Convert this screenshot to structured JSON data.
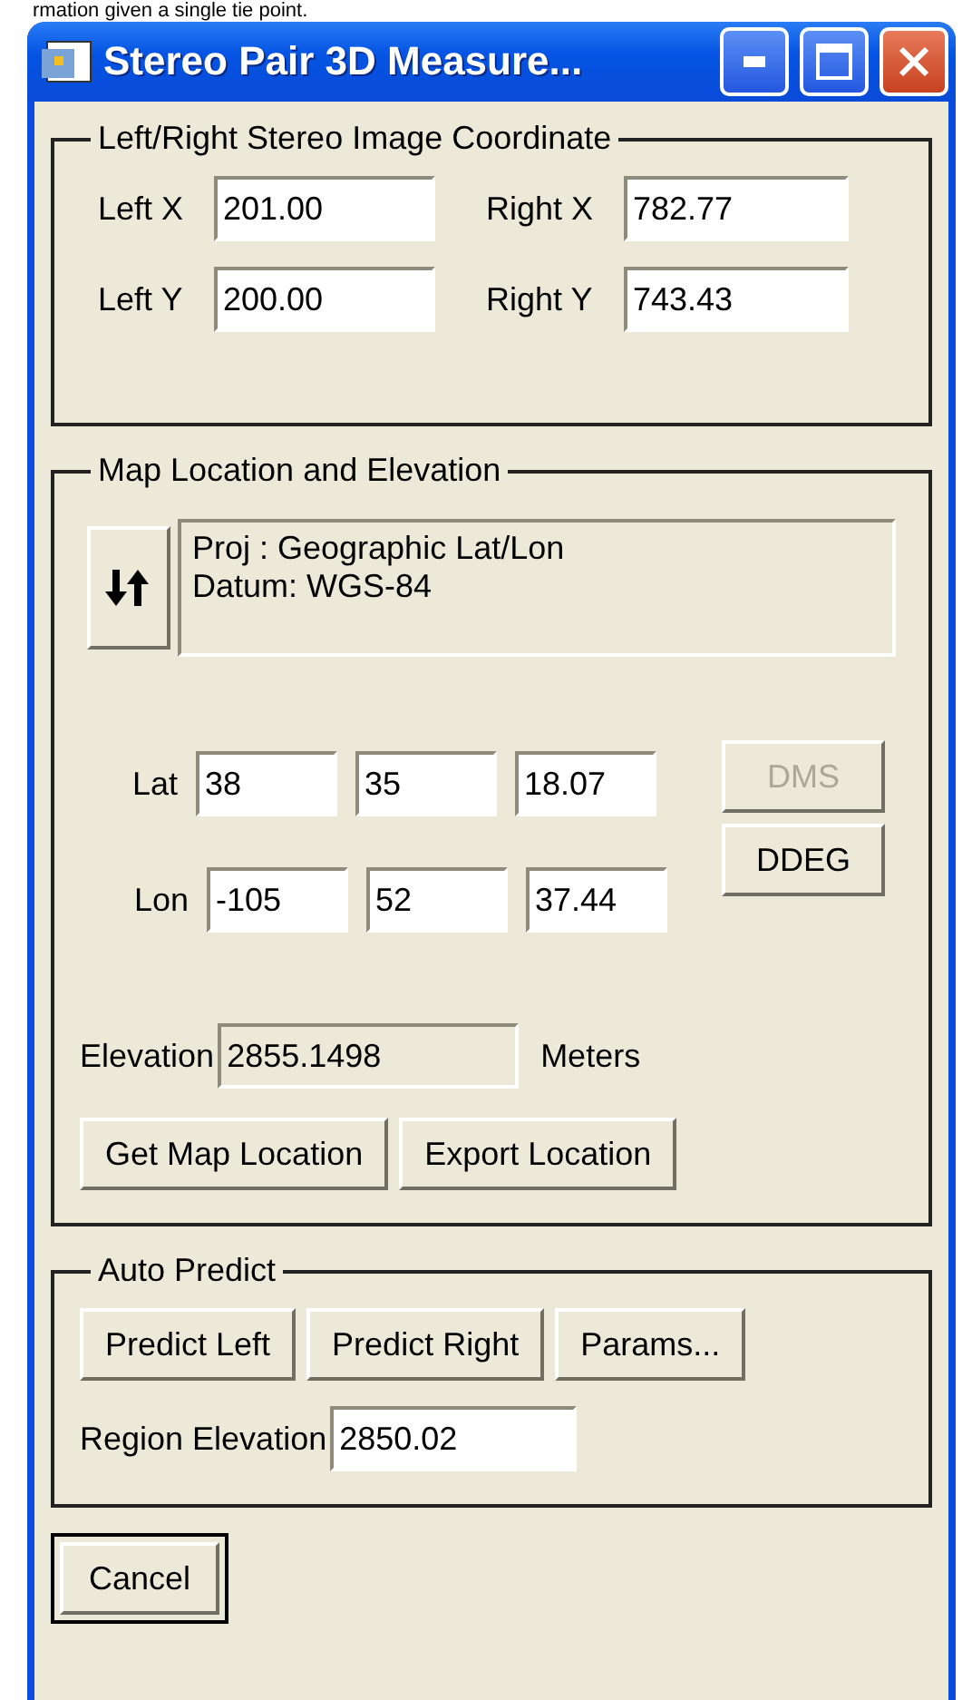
{
  "caption_fragment": "rmation given a single tie point.",
  "window": {
    "title": "Stereo Pair 3D Measure..."
  },
  "image_coordinates": {
    "title": "Left/Right Stereo Image Coordinate",
    "fields": [
      {
        "label": "Left X",
        "value": "201.00"
      },
      {
        "label": "Right X",
        "value": "782.77"
      },
      {
        "label": "Left Y",
        "value": "200.00"
      },
      {
        "label": "Right Y",
        "value": "743.43"
      }
    ]
  },
  "map_location": {
    "title": "Map Location and Elevation",
    "projection_lines": [
      "Proj : Geographic Lat/Lon",
      "Datum: WGS-84"
    ],
    "coordinates": [
      {
        "label": "Lat",
        "values": [
          "38",
          "35",
          "18.07"
        ]
      },
      {
        "label": "Lon",
        "values": [
          "-105",
          "52",
          "37.44"
        ]
      }
    ],
    "format_buttons": [
      {
        "label": "DMS",
        "disabled": true
      },
      {
        "label": "DDEG",
        "disabled": false
      }
    ],
    "elevation": {
      "label": "Elevation",
      "value": "2855.1498",
      "unit": "Meters",
      "readonly": true
    },
    "buttons": [
      "Get Map Location",
      "Export Location"
    ]
  },
  "auto_predict": {
    "title": "Auto Predict",
    "buttons": [
      "Predict Left",
      "Predict Right",
      "Params..."
    ],
    "region_elevation": {
      "label": "Region Elevation",
      "value": "2850.02"
    }
  },
  "footer_buttons": [
    {
      "label": "Cancel",
      "default": true
    }
  ]
}
